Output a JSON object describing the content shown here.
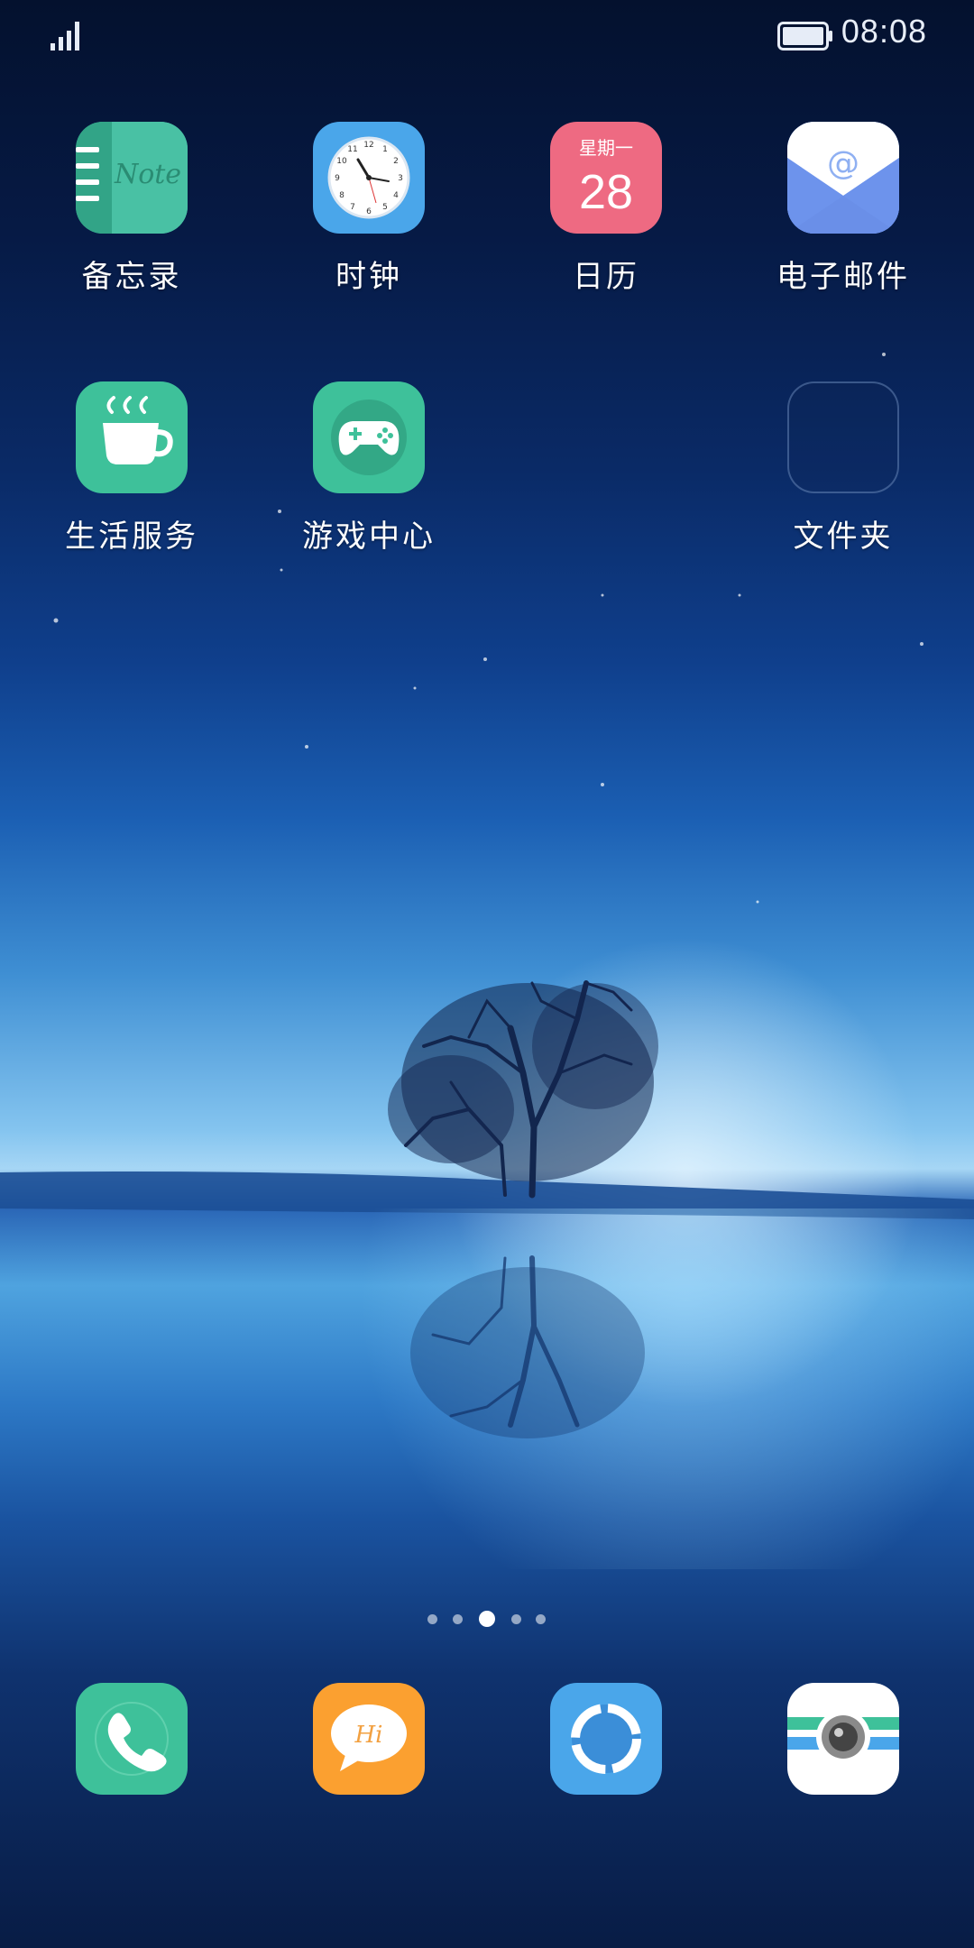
{
  "status_bar": {
    "time": "08:08",
    "signal_icon": "signal-bars-icon",
    "battery_icon": "battery-icon"
  },
  "apps": {
    "notes": {
      "label": "备忘录",
      "icon": "notebook-icon",
      "icon_text": "Note",
      "color": "#3fb59a"
    },
    "clock": {
      "label": "时钟",
      "icon": "clock-icon",
      "color": "#4aa6ea"
    },
    "calendar": {
      "label": "日历",
      "icon": "calendar-icon",
      "weekday": "星期一",
      "day": "28",
      "color": "#ee6a82"
    },
    "email": {
      "label": "电子邮件",
      "icon": "mail-icon",
      "color": "#6f95ee"
    },
    "life_services": {
      "label": "生活服务",
      "icon": "coffee-cup-icon",
      "color": "#3ec19a"
    },
    "game_center": {
      "label": "游戏中心",
      "icon": "gamepad-icon",
      "color": "#3ec19a"
    },
    "folder": {
      "label": "文件夹",
      "icon": "folder-icon"
    }
  },
  "page_indicator": {
    "count": 5,
    "active_index": 2
  },
  "dock": {
    "phone": {
      "icon": "phone-icon",
      "color": "#3ec19a"
    },
    "messages": {
      "icon": "message-bubble-icon",
      "icon_text": "Hi",
      "color": "#fba030"
    },
    "browser": {
      "icon": "browser-ring-icon",
      "color": "#4aa6ea"
    },
    "camera": {
      "icon": "camera-icon",
      "color": "#ffffff"
    }
  }
}
